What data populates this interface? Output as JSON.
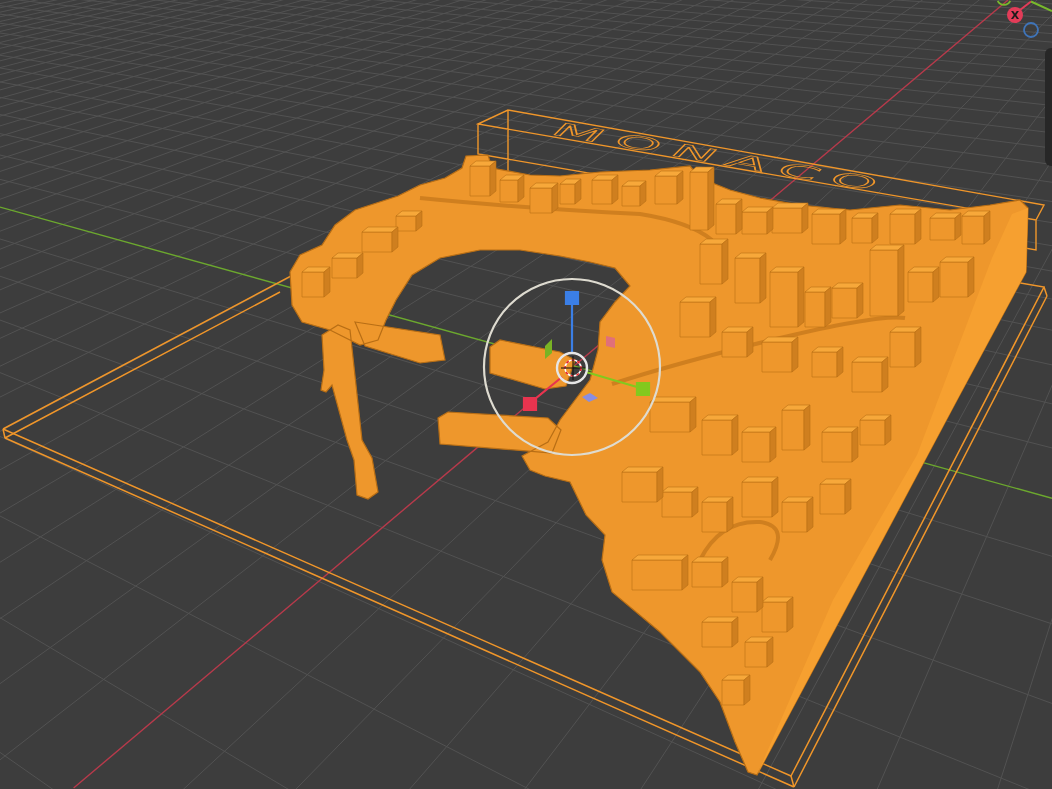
{
  "viewport": {
    "objects": [
      {
        "kind": "base_plate",
        "selected": true
      },
      {
        "kind": "label_plate",
        "selected": true,
        "text": "MONACO"
      },
      {
        "kind": "city_model",
        "selected": true
      }
    ]
  },
  "navigation_gizmo": {
    "axes": [
      {
        "kind": "positive",
        "label": "X",
        "color": "#e23c58"
      },
      {
        "kind": "negative",
        "color": "#3f74b8"
      },
      {
        "kind": "negative",
        "color": "#78b92c"
      }
    ]
  }
}
